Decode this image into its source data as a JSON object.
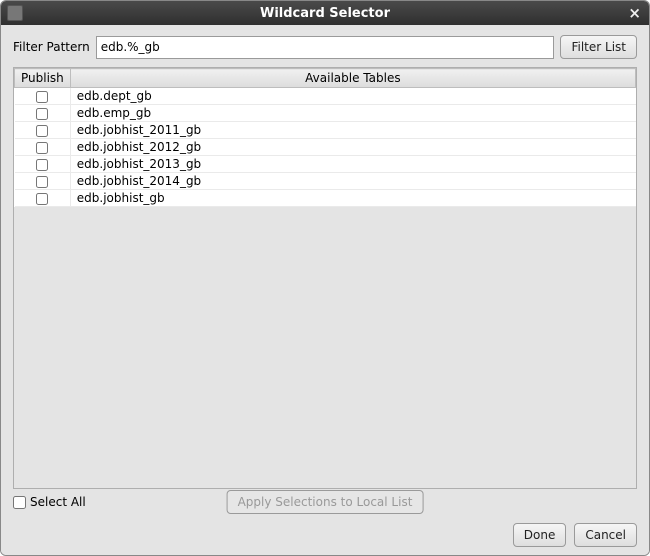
{
  "titlebar": {
    "title": "Wildcard Selector"
  },
  "filter": {
    "label": "Filter Pattern",
    "value": "edb.%_gb",
    "button": "Filter List"
  },
  "table": {
    "headers": {
      "publish": "Publish",
      "available": "Available Tables"
    },
    "rows": [
      {
        "name": "edb.dept_gb"
      },
      {
        "name": "edb.emp_gb"
      },
      {
        "name": "edb.jobhist_2011_gb"
      },
      {
        "name": "edb.jobhist_2012_gb"
      },
      {
        "name": "edb.jobhist_2013_gb"
      },
      {
        "name": "edb.jobhist_2014_gb"
      },
      {
        "name": "edb.jobhist_gb"
      }
    ]
  },
  "footer": {
    "select_all": "Select All",
    "apply": "Apply Selections to Local List",
    "done": "Done",
    "cancel": "Cancel"
  }
}
